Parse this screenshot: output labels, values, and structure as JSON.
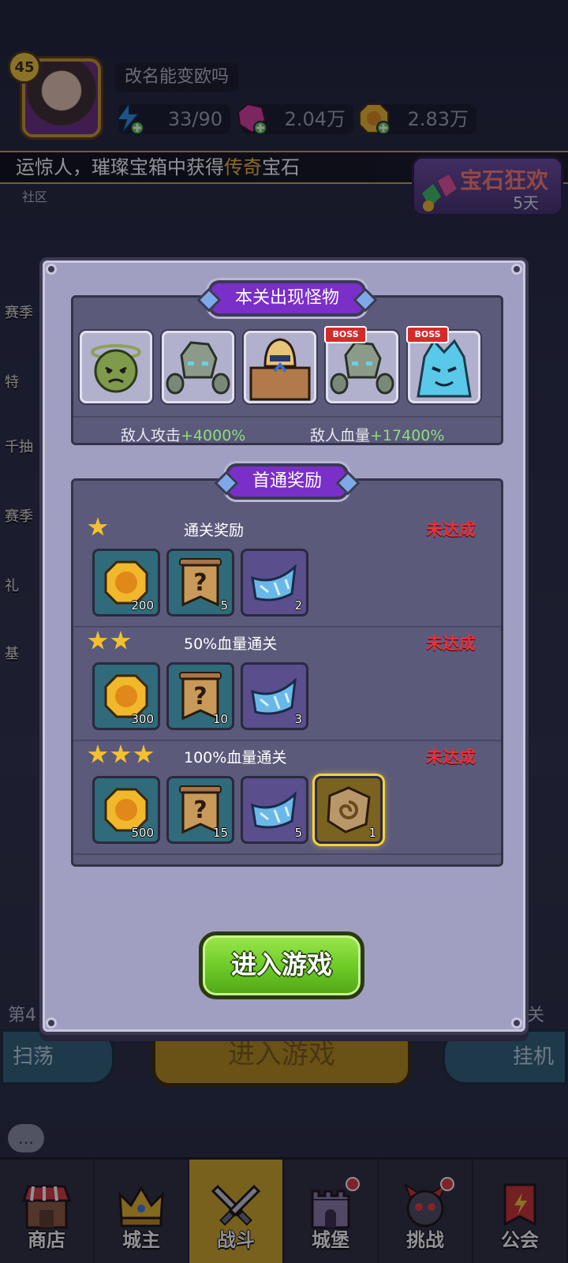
{
  "player": {
    "level": "45",
    "name": "改名能变欧吗",
    "energy": "33/90",
    "gems": "2.04万",
    "gold": "2.83万"
  },
  "notice": {
    "prefix": "运惊人，璀璨宝箱中获得",
    "highlight": "传奇",
    "suffix": "宝石"
  },
  "community_label": "社区",
  "event": {
    "title": "宝石狂欢",
    "days": "5天"
  },
  "side_left": [
    "赛季",
    "特",
    "千抽",
    "赛季",
    "礼",
    "基"
  ],
  "stage": {
    "left": "第4",
    "right": "1关"
  },
  "bottom_actions": {
    "sweep": "扫荡",
    "enter_bg": "进入游戏",
    "idle": "挂机"
  },
  "modal": {
    "monsters": {
      "title": "本关出现怪物",
      "boss_tag": "BOSS",
      "list": [
        {
          "name": "goblin-icon",
          "boss": false
        },
        {
          "name": "rock-golem-icon",
          "boss": false
        },
        {
          "name": "armored-knight-icon",
          "boss": false
        },
        {
          "name": "rock-golem-icon",
          "boss": true
        },
        {
          "name": "ice-spirit-icon",
          "boss": true
        }
      ],
      "attack_label": "敌人攻击",
      "attack_value": "+4000%",
      "hp_label": "敌人血量",
      "hp_value": "+17400%"
    },
    "rewards": {
      "title": "首通奖励",
      "tiers": [
        {
          "stars": 1,
          "name": "通关奖励",
          "status": "未达成",
          "items": [
            {
              "icon": "gold-coin-icon",
              "count": "200"
            },
            {
              "icon": "mystery-scroll-icon",
              "count": "5"
            },
            {
              "icon": "crystal-shard-icon",
              "count": "2"
            }
          ]
        },
        {
          "stars": 2,
          "name": "50%血量通关",
          "status": "未达成",
          "items": [
            {
              "icon": "gold-coin-icon",
              "count": "300"
            },
            {
              "icon": "mystery-scroll-icon",
              "count": "10"
            },
            {
              "icon": "crystal-shard-icon",
              "count": "3"
            }
          ]
        },
        {
          "stars": 3,
          "name": "100%血量通关",
          "status": "未达成",
          "items": [
            {
              "icon": "gold-coin-icon",
              "count": "500"
            },
            {
              "icon": "mystery-scroll-icon",
              "count": "15"
            },
            {
              "icon": "crystal-shard-icon",
              "count": "5"
            },
            {
              "icon": "rune-stone-icon",
              "count": "1"
            }
          ]
        }
      ]
    },
    "enter_button": "进入游戏"
  },
  "nav": [
    {
      "label": "商店",
      "icon": "shop-icon",
      "active": false,
      "dot": false
    },
    {
      "label": "城主",
      "icon": "crown-icon",
      "active": false,
      "dot": false
    },
    {
      "label": "战斗",
      "icon": "swords-icon",
      "active": true,
      "dot": false
    },
    {
      "label": "城堡",
      "icon": "castle-icon",
      "active": false,
      "dot": true
    },
    {
      "label": "挑战",
      "icon": "demon-icon",
      "active": false,
      "dot": true
    },
    {
      "label": "公会",
      "icon": "guild-banner-icon",
      "active": false,
      "dot": false
    }
  ],
  "colors": {
    "panel": "#a09fc1",
    "section": "#5b5a7a",
    "title_purple": "#7a2fc9",
    "status_red": "#e8313a",
    "value_green": "#8ae07a",
    "highlight_orange": "#f4b73e",
    "enter_green": "#6cc926"
  }
}
